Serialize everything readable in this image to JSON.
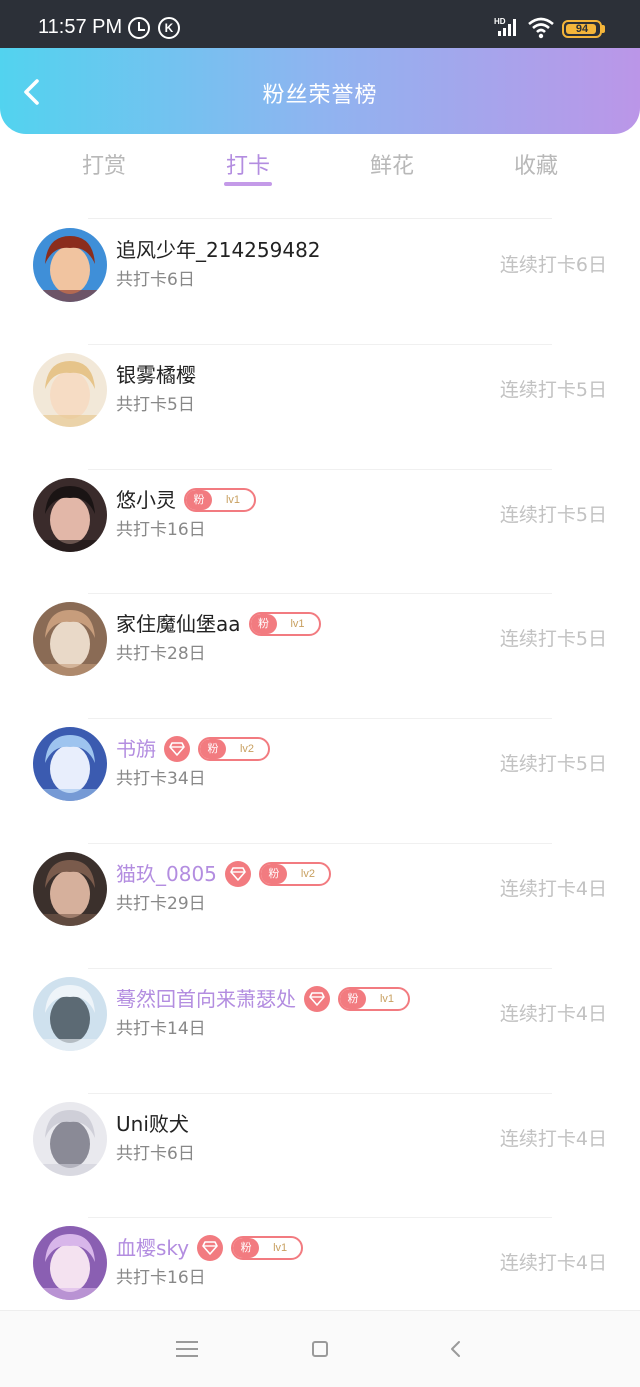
{
  "status_bar": {
    "time": "11:57 PM",
    "alarm_icon": "alarm-clock-icon",
    "k_icon": "k-circle-icon",
    "k_letter": "K",
    "network_label": "HD",
    "battery": "94",
    "battery_level": 0.94,
    "battery_color": "#f4b53a"
  },
  "header": {
    "title": "粉丝荣誉榜",
    "back_icon": "chevron-left-icon",
    "gradient": [
      "#52d3ef",
      "#8fb4f0",
      "#bb96e8"
    ]
  },
  "tabs": [
    {
      "label": "打赏",
      "active": false
    },
    {
      "label": "打卡",
      "active": true
    },
    {
      "label": "鲜花",
      "active": false
    },
    {
      "label": "收藏",
      "active": false
    }
  ],
  "accent_color": "#b38de0",
  "badge_color": "#f27b80",
  "fan_badge_prefix": "粉",
  "list": [
    {
      "name": "追风少年_214259482",
      "vip": false,
      "fan_level": "",
      "total": "共打卡6日",
      "streak": "连续打卡6日"
    },
    {
      "name": "银雾橘樱",
      "vip": false,
      "fan_level": "",
      "total": "共打卡5日",
      "streak": "连续打卡5日"
    },
    {
      "name": "悠小灵",
      "vip": false,
      "fan_level": "lv1",
      "total": "共打卡16日",
      "streak": "连续打卡5日"
    },
    {
      "name": "家住魔仙堡aa",
      "vip": false,
      "fan_level": "lv1",
      "total": "共打卡28日",
      "streak": "连续打卡5日"
    },
    {
      "name": "书旃",
      "vip": true,
      "fan_level": "lv2",
      "total": "共打卡34日",
      "streak": "连续打卡5日"
    },
    {
      "name": "猫玖_0805",
      "vip": true,
      "fan_level": "lv2",
      "total": "共打卡29日",
      "streak": "连续打卡4日"
    },
    {
      "name": "蓦然回首向来萧瑟处",
      "vip": true,
      "fan_level": "lv1",
      "total": "共打卡14日",
      "streak": "连续打卡4日"
    },
    {
      "name": "Uni败犬",
      "vip": false,
      "fan_level": "",
      "total": "共打卡6日",
      "streak": "连续打卡4日"
    },
    {
      "name": "血樱sky",
      "vip": true,
      "fan_level": "lv1",
      "total": "共打卡16日",
      "streak": "连续打卡4日"
    }
  ],
  "nav_bar": {
    "menu_icon": "menu-icon",
    "home_icon": "square-home-icon",
    "back_icon": "triangle-back-icon"
  }
}
